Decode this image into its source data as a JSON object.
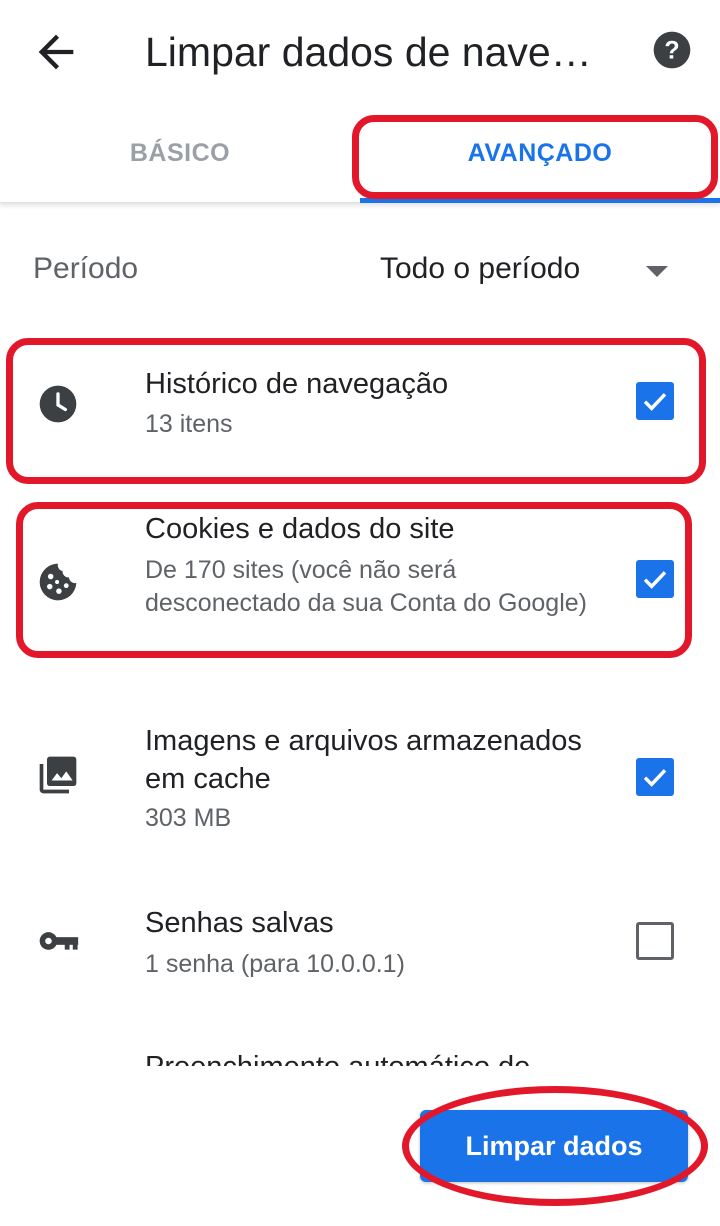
{
  "appbar": {
    "title": "Limpar dados de nave…",
    "back_icon": "arrow-back-icon",
    "help_icon": "help-icon"
  },
  "tabs": [
    {
      "label": "BÁSICO",
      "selected": false
    },
    {
      "label": "AVANÇADO",
      "selected": true
    }
  ],
  "period": {
    "label": "Período",
    "value": "Todo o período"
  },
  "items": [
    {
      "title": "Histórico de navegação",
      "subtitle": "13 itens",
      "icon": "clock-icon",
      "checked": true
    },
    {
      "title": "Cookies e dados do site",
      "subtitle": "De 170 sites (você não será desconectado da sua Conta do Google)",
      "icon": "cookie-icon",
      "checked": true
    },
    {
      "title": "Imagens e arquivos armazenados em cache",
      "subtitle": "303 MB",
      "icon": "images-icon",
      "checked": true
    },
    {
      "title": "Senhas salvas",
      "subtitle": "1 senha (para 10.0.0.1)",
      "icon": "key-icon",
      "checked": false
    },
    {
      "title": "Preenchimento automático de",
      "subtitle": "",
      "icon": "",
      "checked": false
    }
  ],
  "footer": {
    "clear_label": "Limpar dados"
  },
  "colors": {
    "accent": "#1a73e8",
    "highlight": "#e3172a"
  }
}
